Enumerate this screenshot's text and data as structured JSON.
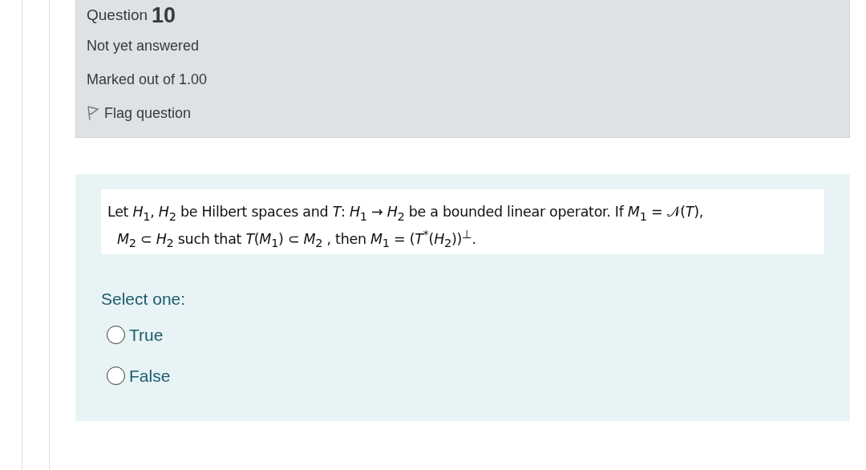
{
  "info": {
    "label": "Question",
    "number": "10",
    "state": "Not yet answered",
    "marks": "Marked out of 1.00",
    "flag": {
      "label": "Flag question",
      "flagged": false
    }
  },
  "question": {
    "lines": [
      "Let *H*$_{1}$, *H*$_{2}$ be Hilbert spaces and *T*: *H*$_{1}$ → *H*$_{2}$ be a bounded linear operator.  If *M*$_{1}$ = 𝒩(*T*),",
      "*M*$_{2}$ ⊂ *H*$_{2}$ such that *T*(*M*$_{1}$) ⊂ *M*$_{2}$ ,  then   *M*$_{1}$ = (*T*$^{*}$(*H*$_{2}$))$^{⊥}$."
    ],
    "prompt": "Select one:",
    "options": [
      {
        "label": "True",
        "selected": false
      },
      {
        "label": "False",
        "selected": false
      }
    ]
  }
}
